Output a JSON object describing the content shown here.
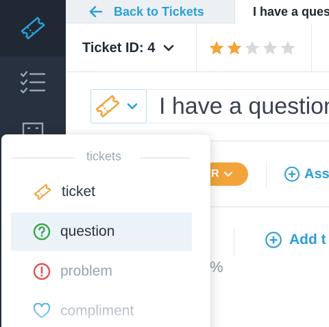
{
  "nav": {
    "items": [
      {
        "icon": "ticket-icon"
      },
      {
        "icon": "task-list-icon"
      },
      {
        "icon": "report-icon"
      }
    ]
  },
  "tabs": {
    "back_label": "Back to Tickets",
    "current_label": "I have a question"
  },
  "ticket": {
    "id_label": "Ticket ID: 4",
    "rating": 2,
    "rating_max": 5,
    "subject": "I have a question"
  },
  "props": {
    "status_label": "R",
    "assign_label": "Ass"
  },
  "lower": {
    "percent_fragment": "%",
    "add_tag_label": "Add t"
  },
  "type_dropdown": {
    "header": "tickets",
    "items": [
      {
        "label": "ticket",
        "icon": "ticket-icon",
        "color": "#f2a33a"
      },
      {
        "label": "question",
        "icon": "question-circle-icon",
        "color": "#3aa54a"
      },
      {
        "label": "problem",
        "icon": "exclamation-circle-icon",
        "color": "#e05252"
      },
      {
        "label": "compliment",
        "icon": "heart-icon",
        "color": "#2a9fd8"
      }
    ]
  },
  "colors": {
    "accent_blue": "#2a9fd8",
    "accent_orange": "#f2a33a",
    "sidebar": "#27313f",
    "star_filled": "#f2a33a",
    "star_empty": "#d5d9de"
  }
}
